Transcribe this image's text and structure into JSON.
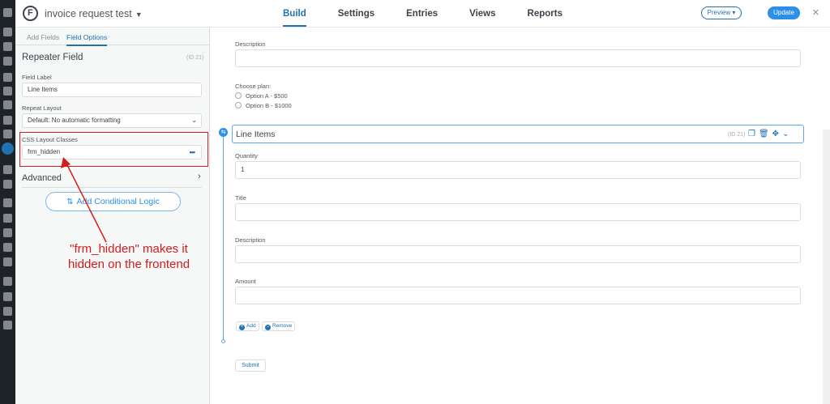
{
  "topbar": {
    "form_title": "invoice request test",
    "tabs": [
      "Build",
      "Settings",
      "Entries",
      "Views",
      "Reports"
    ],
    "active_tab": "Build",
    "preview_label": "Preview",
    "update_label": "Update",
    "close_label": "×"
  },
  "panel": {
    "tabs": [
      "Add Fields",
      "Field Options"
    ],
    "active_tab": "Field Options",
    "field_heading": "Repeater Field",
    "field_id": "(ID 21)",
    "field_label_caption": "Field Label",
    "field_label_value": "Line Items",
    "repeat_layout_caption": "Repeat Layout",
    "repeat_layout_value": "Default: No automatic formatting",
    "css_classes_caption": "CSS Layout Classes",
    "css_classes_value": "frm_hidden",
    "advanced_label": "Advanced",
    "conditional_logic_label": "Add Conditional Logic"
  },
  "annotation": {
    "line1": "\"frm_hidden\" makes it",
    "line2": "hidden on the frontend"
  },
  "main": {
    "description_label": "Description",
    "choose_plan_label": "Choose plan:",
    "plan_options": [
      "Option A - $500",
      "Option B - $1000"
    ],
    "repeater": {
      "title": "Line Items",
      "id": "(ID 21)",
      "quantity_label": "Quantity",
      "quantity_value": "1",
      "title_label": "Title",
      "description_label": "Description",
      "amount_label": "Amount",
      "add_label": "Add",
      "remove_label": "Remove"
    },
    "submit_label": "Submit"
  },
  "colors": {
    "accent": "#2271b1",
    "update_button": "#2e8fe8",
    "annotation_red": "#d01e1e",
    "wp_sidebar": "#1d2327"
  },
  "icons": {
    "logo": "formidable-logo-icon",
    "repeater_tools": [
      "duplicate-icon",
      "trash-icon",
      "move-icon",
      "chevron-down-icon"
    ],
    "conditional": "conditional-logic-icon"
  }
}
